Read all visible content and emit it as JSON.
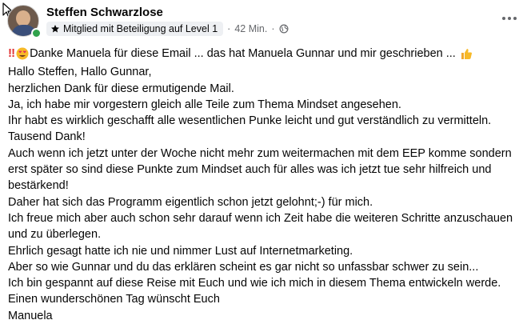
{
  "post": {
    "author": "Steffen Schwarzlose",
    "badge_label": "Mitglied mit Beteiligung auf Level 1",
    "time": "42 Min.",
    "separator": "·",
    "headline": "Danke Manuela für diese Email ... das hat Manuela Gunnar und mir geschrieben ...",
    "lines": [
      "Hallo Steffen, Hallo Gunnar,",
      "herzlichen Dank für diese ermutigende Mail.",
      "Ja, ich habe mir vorgestern gleich alle Teile zum Thema Mindset angesehen.",
      "Ihr habt es wirklich geschafft alle wesentlichen Punke leicht und gut verständlich zu vermitteln.",
      "Tausend Dank!",
      "Auch wenn ich jetzt unter der Woche nicht mehr zum weitermachen mit dem EEP komme sondern",
      "erst später so sind diese Punkte zum Mindset auch für alles was ich jetzt tue sehr hilfreich und",
      "bestärkend!",
      "Daher hat sich das Programm eigentlich schon jetzt gelohnt;-) für mich.",
      "Ich freue mich aber auch schon sehr darauf wenn ich Zeit habe die weiteren Schritte anzuschauen",
      "und zu überlegen.",
      "Ehrlich gesagt hatte ich nie und nimmer Lust auf Internetmarketing.",
      "Aber so wie Gunnar und du das erklären scheint es gar nicht so unfassbar schwer zu sein...",
      "Ich bin gespannt auf diese Reise mit Euch und wie ich mich in diesem Thema entwickeln werde.",
      "Einen wunderschönen Tag wünscht Euch",
      "Manuela"
    ]
  },
  "icons": {
    "badge": "star-icon",
    "audience": "globe-icon",
    "more": "more-options-icon",
    "headline_start": [
      "double-exclamation-icon",
      "heart-eyes-emoji-icon"
    ],
    "headline_end": "thumbs-up-emoji-icon"
  },
  "colors": {
    "online": "#31a24c",
    "exclamation": "#e03131",
    "emoji": "#f7b928",
    "secondary_text": "#65676b"
  }
}
